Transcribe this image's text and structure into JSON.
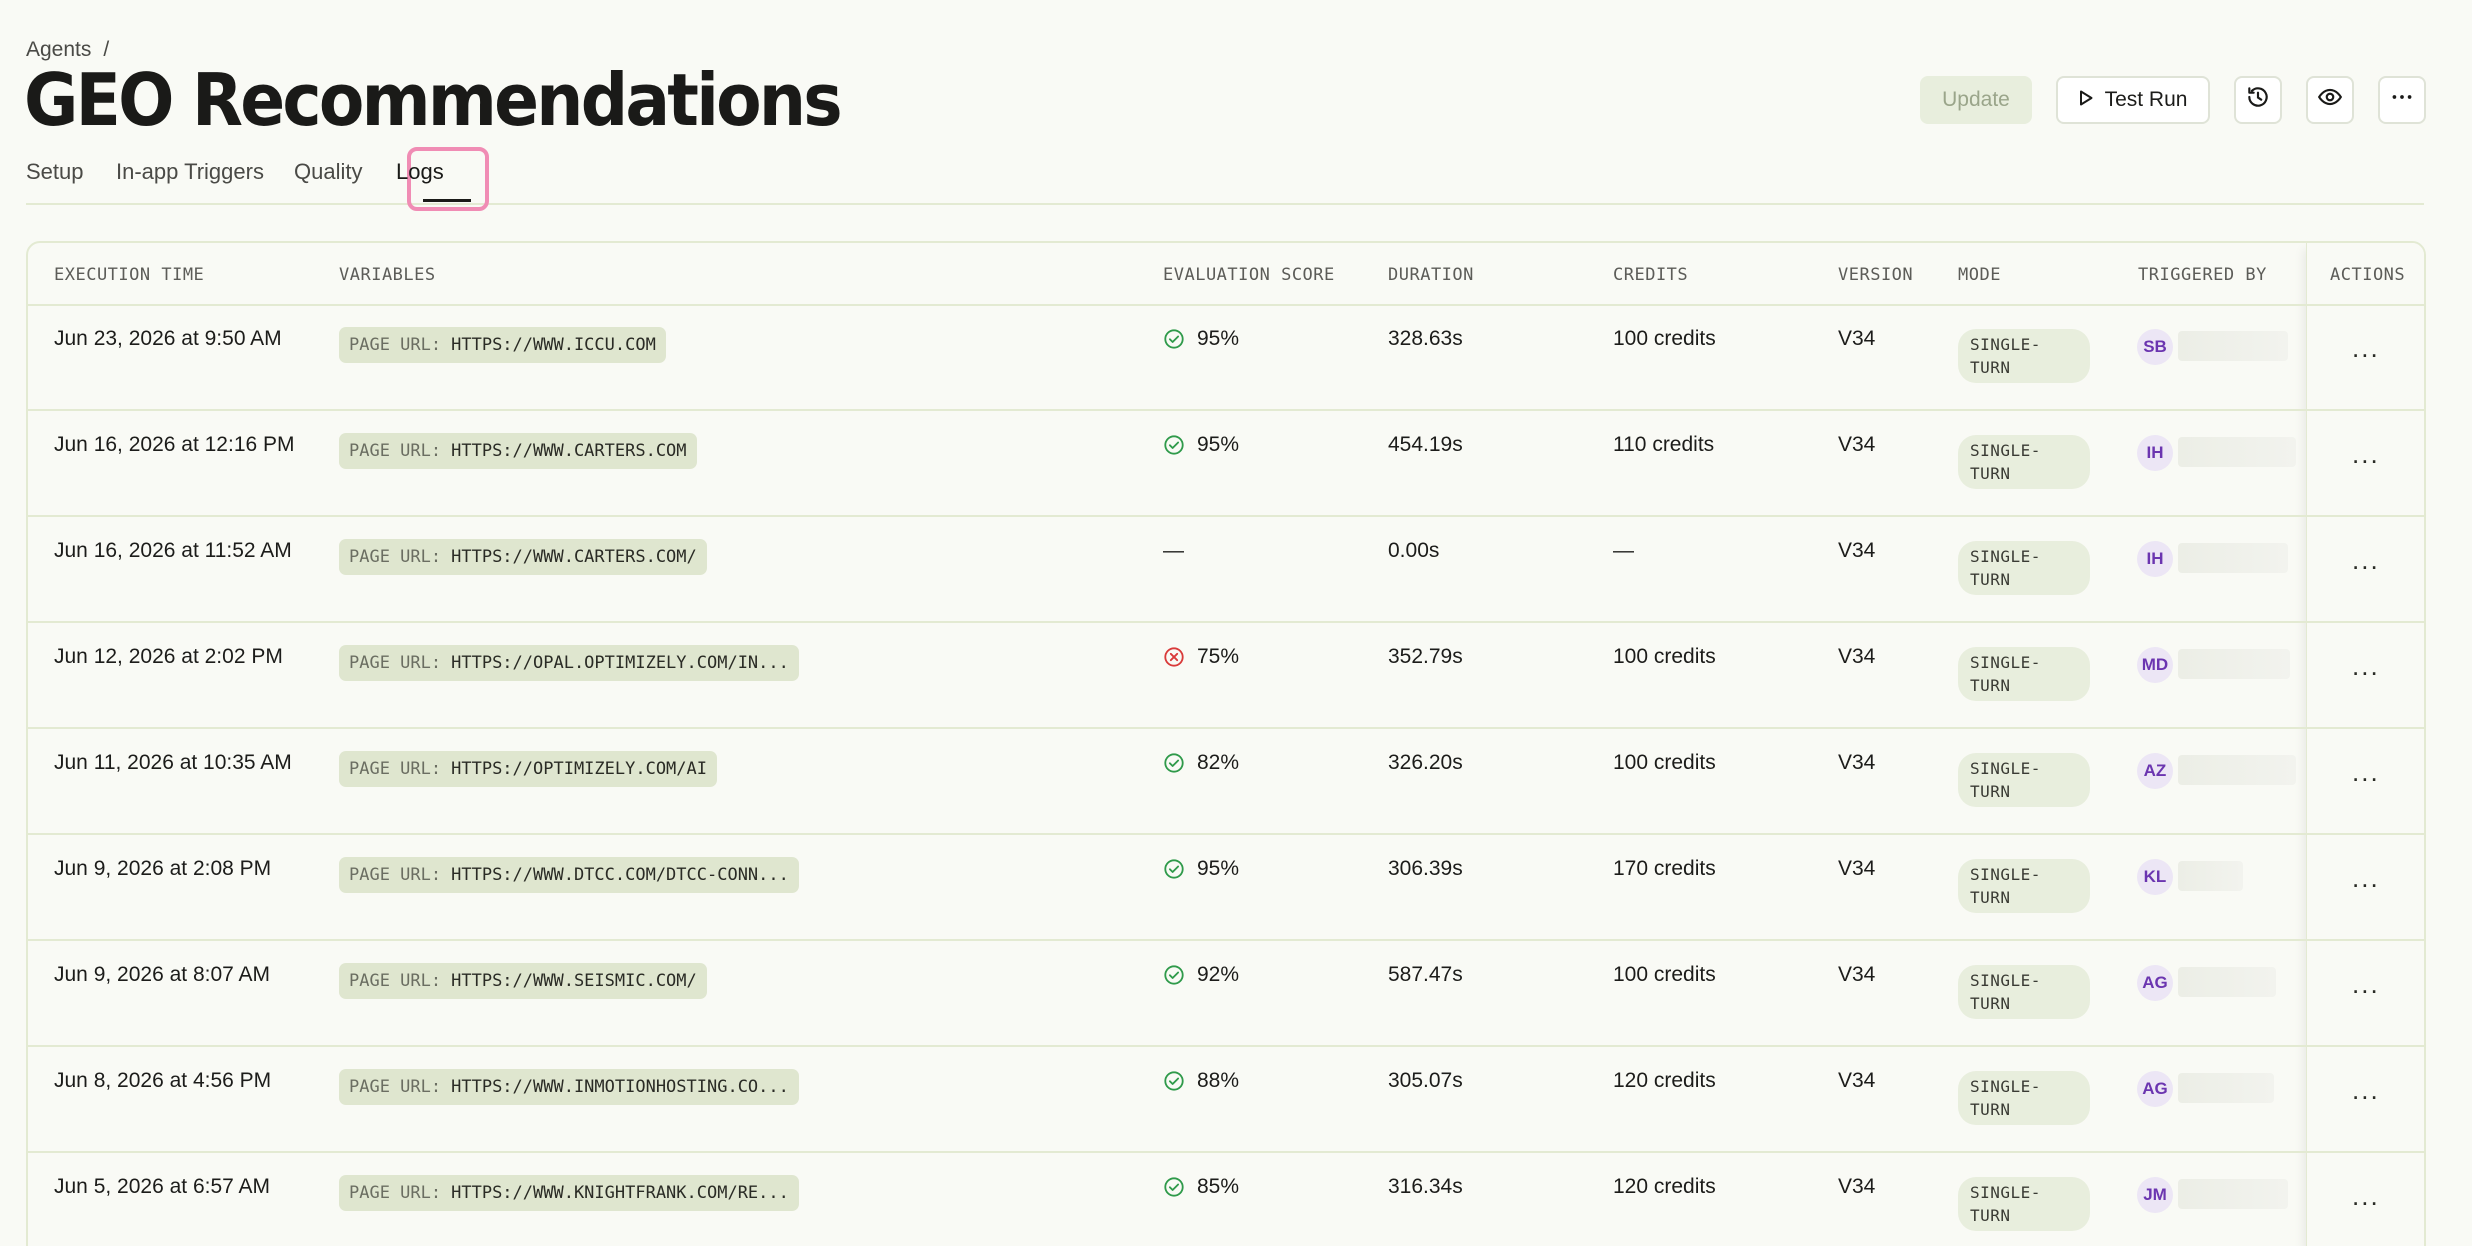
{
  "breadcrumb": {
    "parent": "Agents",
    "separator": "/"
  },
  "title": "GEO Recommendations",
  "tabs": [
    {
      "label": "Setup",
      "active": false
    },
    {
      "label": "In-app Triggers",
      "active": false
    },
    {
      "label": "Quality",
      "active": false
    },
    {
      "label": "Logs",
      "active": true
    }
  ],
  "toolbar": {
    "update_label": "Update",
    "test_run_label": "Test Run",
    "icons": [
      "history-icon",
      "eye-icon",
      "more-horizontal-icon"
    ]
  },
  "table": {
    "columns": [
      "EXECUTION TIME",
      "VARIABLES",
      "EVALUATION SCORE",
      "DURATION",
      "CREDITS",
      "VERSION",
      "MODE",
      "TRIGGERED BY",
      "ACTIONS"
    ],
    "rows": [
      {
        "time": "Jun 23, 2026 at 9:50 AM",
        "var_key": "PAGE URL:",
        "var_val": "HTTPS://WWW.ICCU.COM",
        "status": "pass",
        "score": "95%",
        "duration": "328.63s",
        "credits": "100 credits",
        "version": "V34",
        "mode_line1": "SINGLE-",
        "mode_line2": "TURN",
        "initials": "SB"
      },
      {
        "time": "Jun 16, 2026 at 12:16 PM",
        "var_key": "PAGE URL:",
        "var_val": "HTTPS://WWW.CARTERS.COM",
        "status": "pass",
        "score": "95%",
        "duration": "454.19s",
        "credits": "110 credits",
        "version": "V34",
        "mode_line1": "SINGLE-",
        "mode_line2": "TURN",
        "initials": "IH"
      },
      {
        "time": "Jun 16, 2026 at 11:52 AM",
        "var_key": "PAGE URL:",
        "var_val": "HTTPS://WWW.CARTERS.COM/",
        "status": "none",
        "score": "—",
        "duration": "0.00s",
        "credits": "—",
        "version": "V34",
        "mode_line1": "SINGLE-",
        "mode_line2": "TURN",
        "initials": "IH"
      },
      {
        "time": "Jun 12, 2026 at 2:02 PM",
        "var_key": "PAGE URL:",
        "var_val": "HTTPS://OPAL.OPTIMIZELY.COM/IN...",
        "status": "fail",
        "score": "75%",
        "duration": "352.79s",
        "credits": "100 credits",
        "version": "V34",
        "mode_line1": "SINGLE-",
        "mode_line2": "TURN",
        "initials": "MD"
      },
      {
        "time": "Jun 11, 2026 at 10:35 AM",
        "var_key": "PAGE URL:",
        "var_val": "HTTPS://OPTIMIZELY.COM/AI",
        "status": "pass",
        "score": "82%",
        "duration": "326.20s",
        "credits": "100 credits",
        "version": "V34",
        "mode_line1": "SINGLE-",
        "mode_line2": "TURN",
        "initials": "AZ"
      },
      {
        "time": "Jun 9, 2026 at 2:08 PM",
        "var_key": "PAGE URL:",
        "var_val": "HTTPS://WWW.DTCC.COM/DTCC-CONN...",
        "status": "pass",
        "score": "95%",
        "duration": "306.39s",
        "credits": "170 credits",
        "version": "V34",
        "mode_line1": "SINGLE-",
        "mode_line2": "TURN",
        "initials": "KL"
      },
      {
        "time": "Jun 9, 2026 at 8:07 AM",
        "var_key": "PAGE URL:",
        "var_val": "HTTPS://WWW.SEISMIC.COM/",
        "status": "pass",
        "score": "92%",
        "duration": "587.47s",
        "credits": "100 credits",
        "version": "V34",
        "mode_line1": "SINGLE-",
        "mode_line2": "TURN",
        "initials": "AG"
      },
      {
        "time": "Jun 8, 2026 at 4:56 PM",
        "var_key": "PAGE URL:",
        "var_val": "HTTPS://WWW.INMOTIONHOSTING.CO...",
        "status": "pass",
        "score": "88%",
        "duration": "305.07s",
        "credits": "120 credits",
        "version": "V34",
        "mode_line1": "SINGLE-",
        "mode_line2": "TURN",
        "initials": "AG"
      },
      {
        "time": "Jun 5, 2026 at 6:57 AM",
        "var_key": "PAGE URL:",
        "var_val": "HTTPS://WWW.KNIGHTFRANK.COM/RE...",
        "status": "pass",
        "score": "85%",
        "duration": "316.34s",
        "credits": "120 credits",
        "version": "V34",
        "mode_line1": "SINGLE-",
        "mode_line2": "TURN",
        "initials": "JM"
      }
    ],
    "row_action_label": "..."
  },
  "colors": {
    "background": "#f9faf5",
    "pill": "#dfe6cf",
    "pass": "#2f9a4a",
    "fail": "#d93a3a",
    "tab_highlight": "#f08cb4",
    "avatar_text": "#6b35b0"
  }
}
